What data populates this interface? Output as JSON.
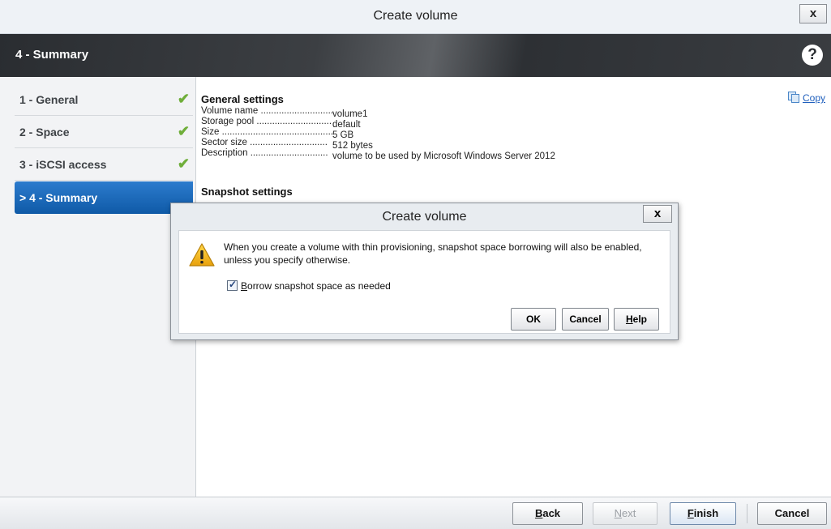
{
  "window": {
    "title": "Create volume",
    "close_label": "x"
  },
  "header": {
    "step_title": "4 - Summary",
    "help_label": "?"
  },
  "steps": [
    {
      "label": "1 - General",
      "check": "✔"
    },
    {
      "label": "2 - Space",
      "check": "✔"
    },
    {
      "label": "3 - iSCSI access",
      "check": "✔"
    },
    {
      "label": "> 4 - Summary",
      "check": ""
    }
  ],
  "summary": {
    "copy_label": "Copy",
    "general_title": "General settings",
    "general": [
      {
        "key": "Volume name ..............................",
        "value": "volume1"
      },
      {
        "key": "Storage pool ..............................",
        "value": "default"
      },
      {
        "key": "Size ....................................................",
        "value": "5 GB"
      },
      {
        "key": "Sector size ..............................",
        "value": "512 bytes"
      },
      {
        "key": "Description ..............................",
        "value": "volume to be used by Microsoft Windows Server 2012"
      }
    ],
    "snapshot_title": "Snapshot settings"
  },
  "dialog": {
    "title": "Create volume",
    "close_label": "x",
    "message_line1": "When you create a volume with thin provisioning, snapshot space borrowing will also be enabled,",
    "message_line2": "unless you specify otherwise.",
    "checkbox_label_mnemonic": "B",
    "checkbox_label_rest": "orrow snapshot space as needed",
    "checkbox_checked": true,
    "ok_label": "OK",
    "cancel_label": "Cancel",
    "help_mnemonic": "H",
    "help_rest": "elp"
  },
  "footer": {
    "back_mnemonic": "B",
    "back_rest": "ack",
    "next_mnemonic": "N",
    "next_rest": "ext",
    "finish_mnemonic": "F",
    "finish_rest": "inish",
    "cancel_label": "Cancel"
  },
  "colors": {
    "accent": "#1a66b8",
    "check_green": "#6fae3a",
    "warning": "#f2b81d",
    "link": "#1f5fbd"
  }
}
